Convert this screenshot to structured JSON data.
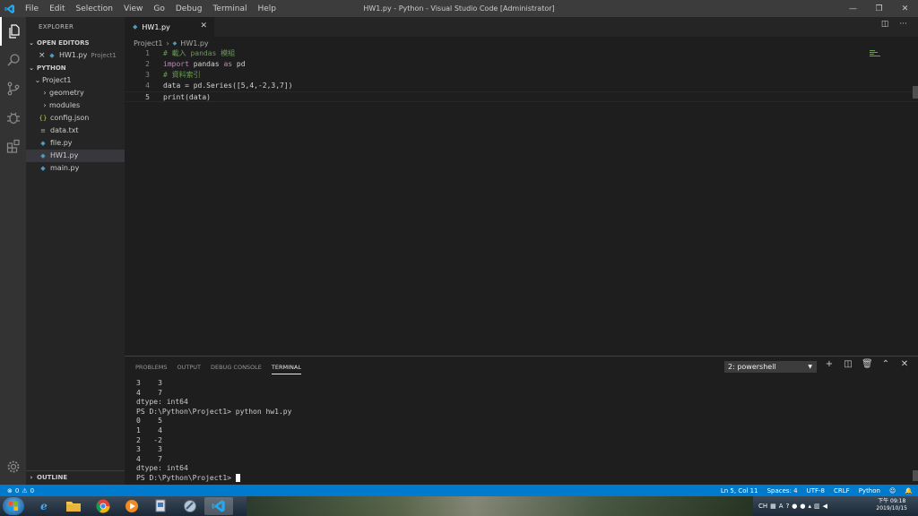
{
  "window": {
    "title": "HW1.py - Python - Visual Studio Code [Administrator]",
    "menu": [
      "File",
      "Edit",
      "Selection",
      "View",
      "Go",
      "Debug",
      "Terminal",
      "Help"
    ]
  },
  "sidebar": {
    "title": "EXPLORER",
    "open_editors": {
      "label": "OPEN EDITORS",
      "items": [
        {
          "name": "HW1.py",
          "folder": "Project1"
        }
      ]
    },
    "workspace": {
      "label": "PYTHON",
      "root": "Project1",
      "items": [
        {
          "label": "geometry",
          "kind": "folder"
        },
        {
          "label": "modules",
          "kind": "folder"
        },
        {
          "label": "config.json",
          "kind": "json"
        },
        {
          "label": "data.txt",
          "kind": "txt"
        },
        {
          "label": "file.py",
          "kind": "py"
        },
        {
          "label": "HW1.py",
          "kind": "py"
        },
        {
          "label": "main.py",
          "kind": "py"
        }
      ]
    },
    "outline_label": "OUTLINE"
  },
  "editor": {
    "tab_label": "HW1.py",
    "breadcrumb": [
      "Project1",
      "HW1.py"
    ],
    "lines": [
      {
        "num": "1",
        "text": "# 載入 pandas 模組"
      },
      {
        "num": "2",
        "kw": "import",
        "mid": " pandas ",
        "kw2": "as",
        "end": " pd"
      },
      {
        "num": "3",
        "text": "# 資料索引"
      },
      {
        "num": "4",
        "text": "data = pd.Series([5,4,-2,3,7])"
      },
      {
        "num": "5",
        "text": "print(data)"
      }
    ]
  },
  "panel": {
    "tabs": [
      "PROBLEMS",
      "OUTPUT",
      "DEBUG CONSOLE",
      "TERMINAL"
    ],
    "active_tab": "TERMINAL",
    "terminal_select": "2: powershell",
    "terminal_lines": [
      "3    3",
      "4    7",
      "dtype: int64",
      "PS D:\\Python\\Project1> python hw1.py",
      "0    5",
      "1    4",
      "2   -2",
      "3    3",
      "4    7",
      "dtype: int64",
      "PS D:\\Python\\Project1> "
    ]
  },
  "statusbar": {
    "errors": "0",
    "warnings": "0",
    "position": "Ln 5, Col 11",
    "spaces": "Spaces: 4",
    "encoding": "UTF-8",
    "eol": "CRLF",
    "language": "Python"
  },
  "taskbar": {
    "clock_ampm": "下午 09:18",
    "clock_date": "2019/10/15",
    "ime": "CH"
  },
  "colors": {
    "accent": "#007acc",
    "titlebar": "#3c3c3c",
    "sidebar": "#252526",
    "editor": "#1e1e1e"
  }
}
